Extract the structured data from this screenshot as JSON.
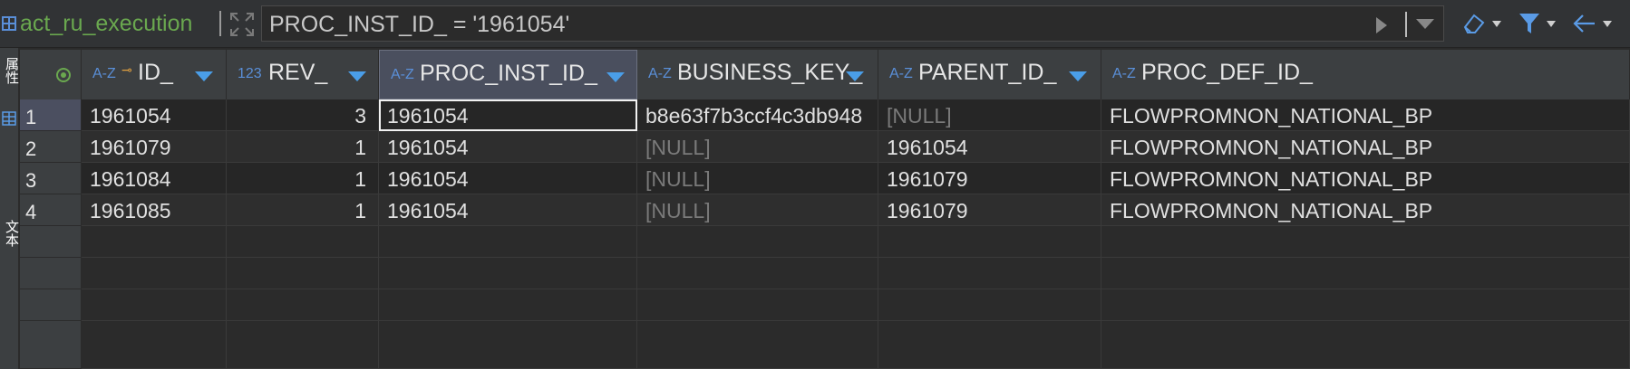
{
  "toolbar": {
    "table_name": "act_ru_execution",
    "filter_value": "PROC_INST_ID_ = '1961054'",
    "accent_color": "#6aa84f"
  },
  "side_tab": {
    "label_1": "属性",
    "label_2": "文本"
  },
  "columns": [
    {
      "type": "A-Z",
      "key": true,
      "label": "ID_",
      "sort": true
    },
    {
      "type": "123",
      "key": false,
      "label": "REV_",
      "sort": true
    },
    {
      "type": "A-Z",
      "key": false,
      "label": "PROC_INST_ID_",
      "sort": true
    },
    {
      "type": "A-Z",
      "key": false,
      "label": "BUSINESS_KEY_",
      "sort": true
    },
    {
      "type": "A-Z",
      "key": false,
      "label": "PARENT_ID_",
      "sort": true
    },
    {
      "type": "A-Z",
      "key": false,
      "label": "PROC_DEF_ID_",
      "sort": false
    }
  ],
  "rows": [
    {
      "num": "1",
      "cells": [
        "1961054",
        "3",
        "1961054",
        "b8e63f7b3ccf4c3db948",
        "[NULL]",
        "FLOWPROMNON_NATIONAL_BP"
      ]
    },
    {
      "num": "2",
      "cells": [
        "1961079",
        "1",
        "1961054",
        "[NULL]",
        "1961054",
        "FLOWPROMNON_NATIONAL_BP"
      ]
    },
    {
      "num": "3",
      "cells": [
        "1961084",
        "1",
        "1961054",
        "[NULL]",
        "1961079",
        "FLOWPROMNON_NATIONAL_BP"
      ]
    },
    {
      "num": "4",
      "cells": [
        "1961085",
        "1",
        "1961054",
        "[NULL]",
        "1961079",
        "FLOWPROMNON_NATIONAL_BP"
      ]
    }
  ]
}
